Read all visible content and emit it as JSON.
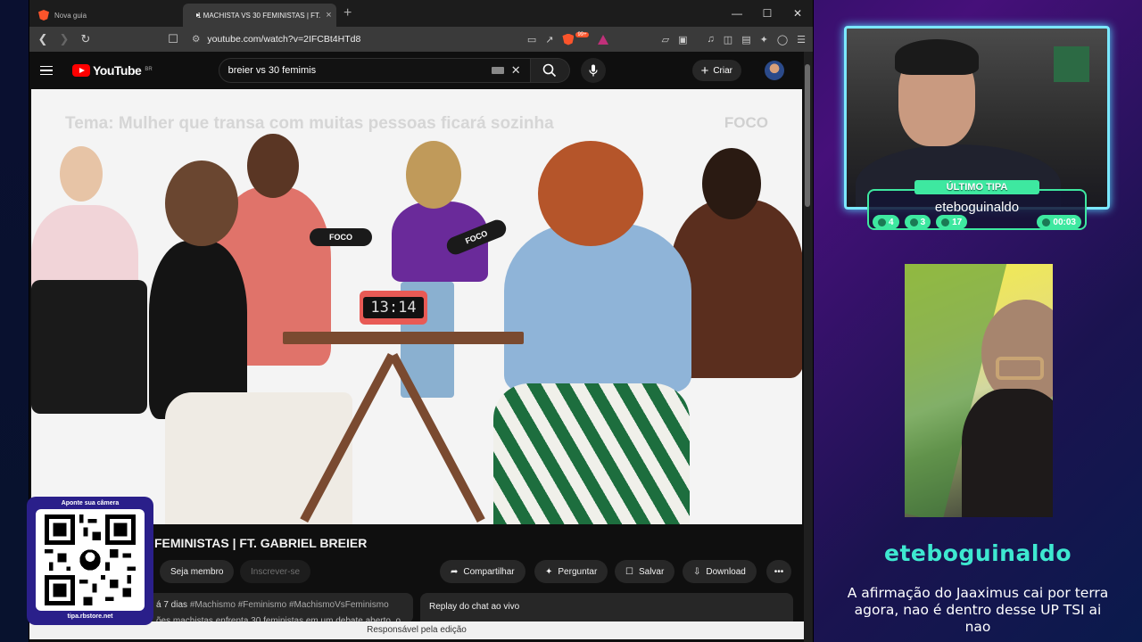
{
  "browser": {
    "tabs": [
      {
        "label": "Nova guia",
        "active": false
      },
      {
        "label": "1 MACHISTA VS 30 FEMINISTAS | FT.",
        "active": true
      }
    ],
    "url": "youtube.com/watch?v=2IFCBt4HTd8",
    "brave_badge": "99+",
    "alert_badge": "1"
  },
  "youtube": {
    "logo_text": "YouTube",
    "region": "BR",
    "search_value": "breier vs 30 femimis",
    "create_label": "Criar",
    "video": {
      "topic_overlay": "Tema: Mulher que transa com muitas pessoas ficará sozinha",
      "brand_overlay": "FOCO",
      "clock": "13:14",
      "mic_label": "FOCO"
    },
    "title_partial": "FEMINISTAS | FT. GABRIEL BREIER",
    "join_label": "Seja membro",
    "subscribe_label": "Inscrever-se",
    "share_label": "Compartilhar",
    "ask_label": "Perguntar",
    "save_label": "Salvar",
    "download_label": "Download",
    "desc_age": "á 7 dias",
    "desc_tags": "#Machismo #Feminismo #MachismoVsFeminismo",
    "desc_line2": "ões machistas enfrenta 30 feministas em um debate aberto, o",
    "chat_replay_label": "Replay do chat ao vivo",
    "status_text": "Responsável pela edição"
  },
  "qr_overlay": {
    "caption": "Aponte sua câmera",
    "footer": "tipa.rbstore.net"
  },
  "stream": {
    "tipa_title": "ÚLTIMO TIPA",
    "tipa_name": "eteboguinaldo",
    "stats": [
      "4",
      "3",
      "17",
      "00:03"
    ],
    "message_user": "eteboguinaldo",
    "message_text": "A afirmação do Jaaximus cai por terra agora, nao é dentro desse UP TSI ai nao"
  },
  "colors": {
    "accent_teal": "#3ee8a0",
    "accent_cyan": "#7be8ff",
    "yt_red": "#ff0000",
    "brave_orange": "#fb542b"
  }
}
